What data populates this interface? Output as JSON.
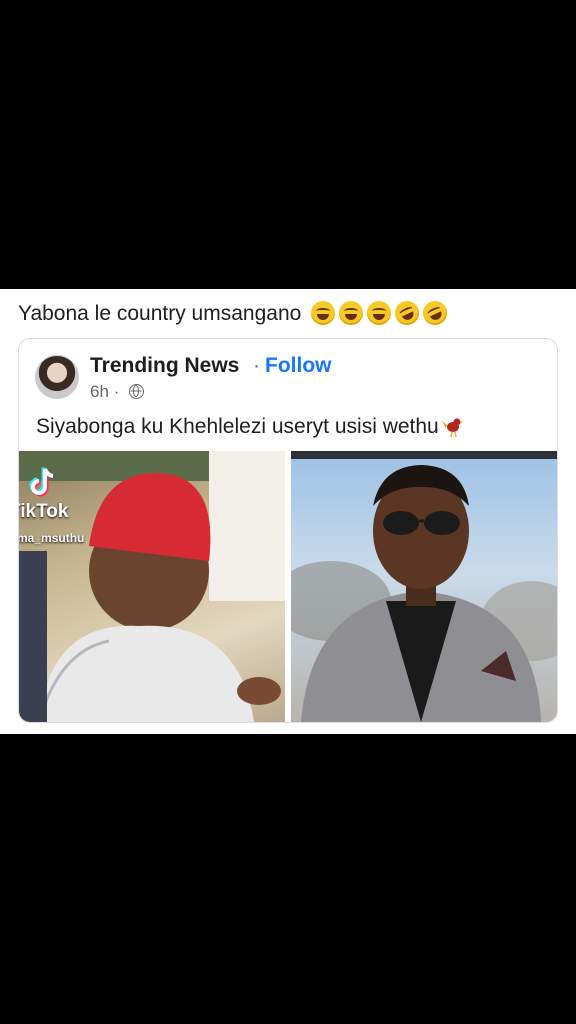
{
  "post": {
    "caption": "Yabona le country umsangano",
    "caption_emojis": [
      "face-with-tears-of-joy",
      "face-with-tears-of-joy",
      "face-with-tears-of-joy",
      "rolling-on-floor-laughing",
      "rolling-on-floor-laughing"
    ]
  },
  "shared": {
    "page_name": "Trending News",
    "separator": "·",
    "follow_label": "Follow",
    "time": "6h ·",
    "audience_icon": "globe-icon",
    "text": "Siyabonga ku Khehlelezi useryt usisi wethu",
    "text_emoji": "bird-emoji",
    "photos": [
      {
        "subject": "tiktok-screenshot",
        "watermark": "TikTok",
        "watermark_user": "ma_msuthu"
      },
      {
        "subject": "portrait"
      }
    ]
  },
  "colors": {
    "link": "#1877f2",
    "text": "#1c1e21",
    "muted": "#65676b",
    "background": "#000000"
  }
}
